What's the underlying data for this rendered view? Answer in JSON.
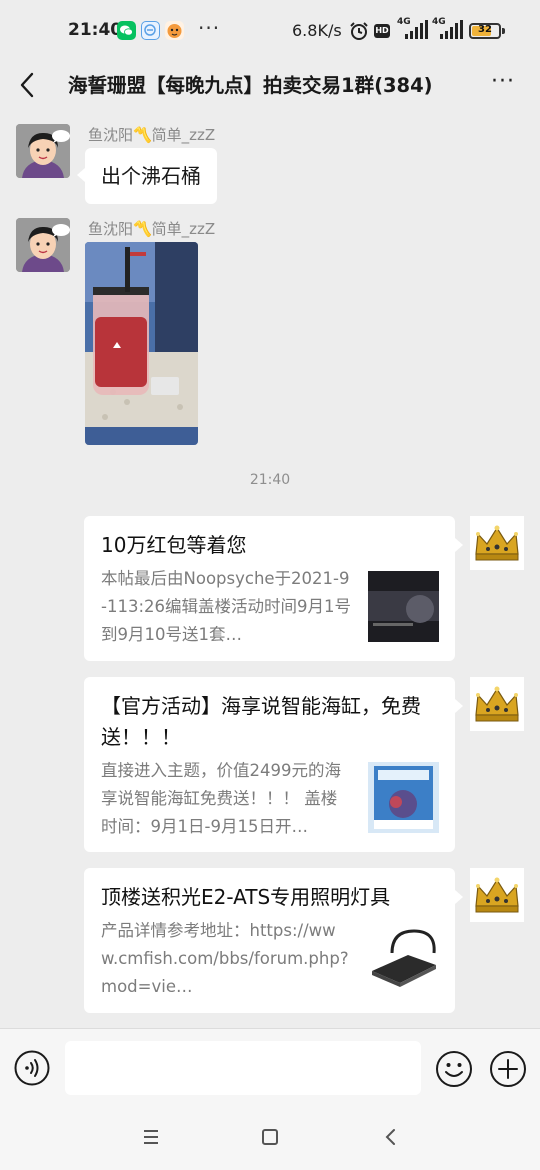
{
  "status_bar": {
    "time": "21:40",
    "more_indicator": "···",
    "net_speed": "6.8K/s",
    "hd_badge": "HD",
    "signal_1": "4G",
    "signal_2": "4G",
    "battery": "32"
  },
  "header": {
    "title": "海誓珊盟【每晚九点】拍卖交易1群(384)",
    "back_icon": "chevron-left-icon",
    "more_label": "···"
  },
  "messages": [
    {
      "sender": "鱼沈阳〽️简单_zzZ",
      "text": "出个沸石桶"
    },
    {
      "sender": "鱼沈阳〽️简单_zzZ",
      "image": "photo-of-zeolite-reactor"
    }
  ],
  "timestamp": "21:40",
  "cards": [
    {
      "title": "10万红包等着您",
      "desc": "本帖最后由Noopsyche于2021-9-113:26编辑盖楼活动时间9月1号到9月10号送1套…",
      "thumb": "dark-aquarium-equipment"
    },
    {
      "title": "【官方活动】海享说智能海缸，免费送！！！",
      "desc": "直接进入主题，价值2499元的海享说智能海缸免费送！！！ 盖楼时间：9月1日-9月15日开…",
      "thumb": "smart-aquarium-box"
    },
    {
      "title": "顶楼送积光E2-ATS专用照明灯具",
      "desc": "产品详情参考地址：https://www.cmfish.com/bbs/forum.php?mod=vie…",
      "thumb": "ats-light-fixture"
    }
  ],
  "input_bar": {
    "voice_icon": "voice-icon",
    "input_value": "",
    "emoji_icon": "emoji-icon",
    "plus_icon": "plus-icon"
  },
  "nav_bar": {
    "menu_icon": "menu-icon",
    "home_icon": "home-icon",
    "back_icon": "back-icon"
  },
  "colors": {
    "background": "#ededed",
    "bubble": "#ffffff",
    "sender_name": "#8a8a8a",
    "desc_text": "#7c7c7c",
    "battery_fill": "#f0b33a",
    "wechat_green": "#07c160"
  }
}
